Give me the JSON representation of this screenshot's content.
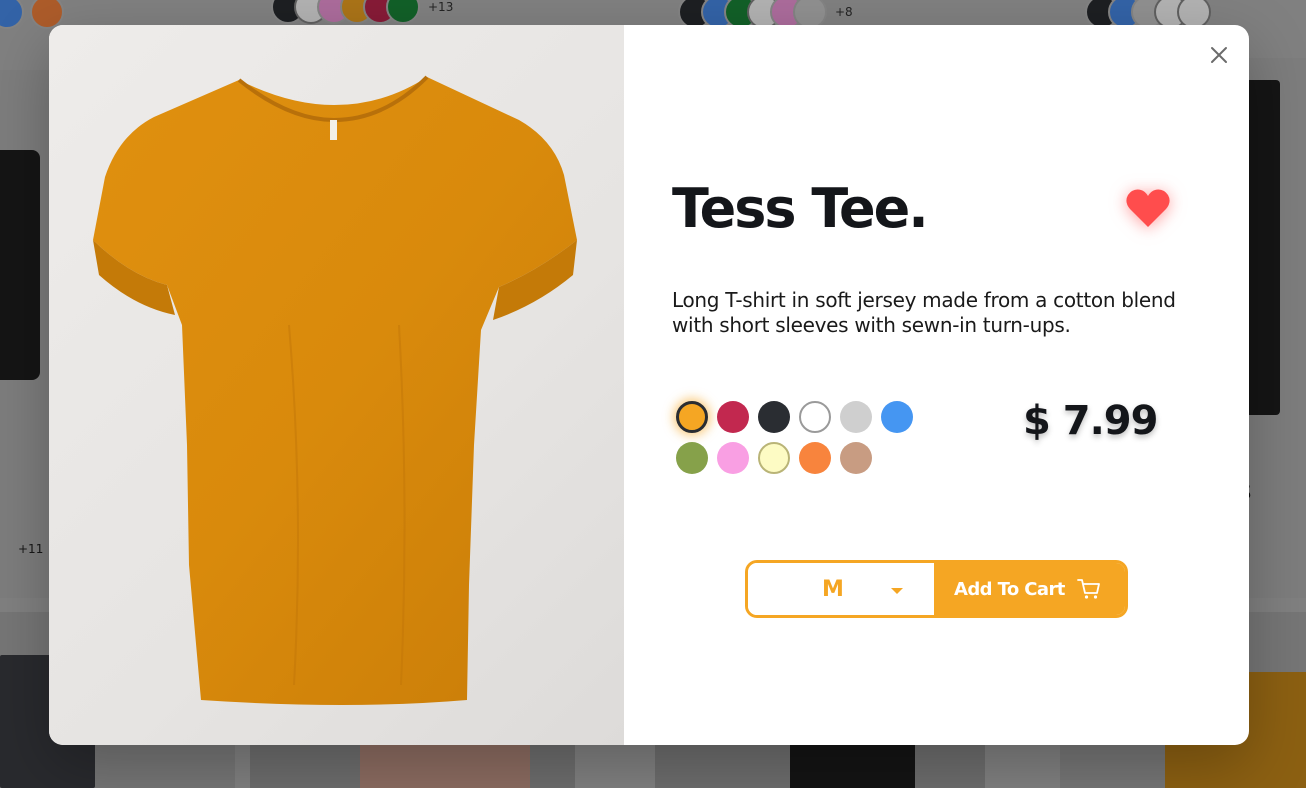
{
  "background": {
    "col1": {
      "more": "+13",
      "dots": [
        "#2a2d32",
        "#ffffff",
        "#f79be0",
        "#f5a623",
        "#c2284f",
        "#1a8a3a"
      ]
    },
    "col2": {
      "more": "+8",
      "dots": [
        "#2a2d32",
        "#4a8ef0",
        "#1a8a3a",
        "#ffffff",
        "#f79be0",
        "#cfcfcf"
      ]
    },
    "col3": {
      "dots": [
        "#2a2d32",
        "#4a8ef0",
        "#cfcfcf",
        "#ffffff",
        "#ffffff"
      ]
    },
    "left_count": "+11",
    "right_text": "s"
  },
  "modal": {
    "title": "Tess Tee.",
    "description": "Long T-shirt in soft jersey made from a cotton blend with short sleeves with sewn-in turn-ups.",
    "price": "$ 7.99",
    "accent_color": "#f5a623",
    "favorite_color": "#ff4d4d",
    "swatches": [
      {
        "color": "#f5a623",
        "selected": true
      },
      {
        "color": "#c2284f",
        "selected": false
      },
      {
        "color": "#2a2d32",
        "selected": false
      },
      {
        "color": "#ffffff",
        "selected": false
      },
      {
        "color": "#cfcfcf",
        "selected": false
      },
      {
        "color": "#4596f2",
        "selected": false
      },
      {
        "color": "#86a14a",
        "selected": false
      },
      {
        "color": "#f99fe3",
        "selected": false
      },
      {
        "color": "#fdfbc4",
        "selected": false
      },
      {
        "color": "#f8843d",
        "selected": false
      },
      {
        "color": "#c89c82",
        "selected": false
      }
    ],
    "size": {
      "selected": "M"
    },
    "add_to_cart_label": "Add To Cart",
    "icons": {
      "close": "close-icon",
      "favorite": "heart-icon",
      "cart": "cart-icon",
      "dropdown": "chevron-down-icon"
    }
  }
}
